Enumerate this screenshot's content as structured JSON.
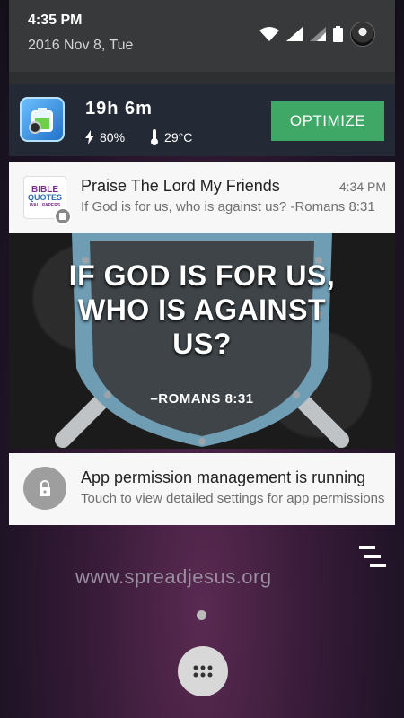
{
  "status": {
    "time": "4:35 PM",
    "date": "2016 Nov 8, Tue",
    "icons": [
      "wifi-icon",
      "signal-icon",
      "signal-weak-icon",
      "battery-icon",
      "avatar"
    ]
  },
  "battery_card": {
    "duration": "19h 6m",
    "charge": "80%",
    "temperature": "29°C",
    "action_label": "OPTIMIZE",
    "colors": {
      "background": "#232a35",
      "button": "#3fa867"
    }
  },
  "notification_bible": {
    "app_icon_lines": [
      "BIBLE",
      "QUOTES",
      "WALLPAPERS"
    ],
    "title": "Praise The Lord My Friends",
    "text": "If God is for us, who is against us? -Romans 8:31",
    "time": "4:34 PM",
    "picture": {
      "line1": "IF GOD IS FOR US,",
      "line2": "WHO IS AGAINST",
      "line3": "US?",
      "reference": "–ROMANS 8:31"
    }
  },
  "notification_permission": {
    "title": "App permission management is running",
    "text": "Touch to view detailed settings for app permissions"
  },
  "wallpaper": {
    "watermark": "www.spreadjesus.org"
  }
}
